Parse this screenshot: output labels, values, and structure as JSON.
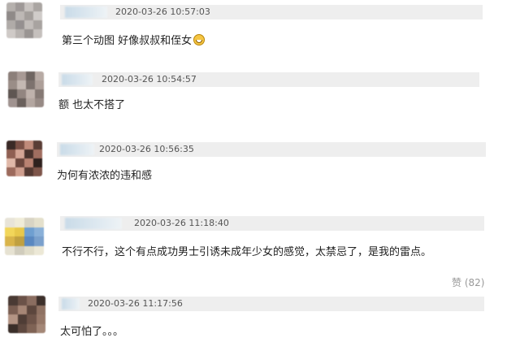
{
  "comments": [
    {
      "timestamp": "2020-03-26 10:57:03",
      "text": "第三个动图 好像叔叔和侄女",
      "emoji": "grinning-face-emoji",
      "avatar_colors": [
        "#b5b0ad",
        "#9e9897",
        "#c8c3c0",
        "#aaa5a2",
        "#8f8a88",
        "#bdb8b5",
        "#a39e9b",
        "#d0ccc9",
        "#b0aba8",
        "#959090",
        "#c2bdba",
        "#a8a3a0",
        "#cfcac7",
        "#b8b3b0",
        "#9a9593",
        "#c5c0bd"
      ]
    },
    {
      "timestamp": "2020-03-26 10:54:57",
      "text": "额 也太不搭了",
      "avatar_colors": [
        "#8c7f7a",
        "#a89a95",
        "#6f6561",
        "#b7aaa4",
        "#9a8d87",
        "#c4b8b2",
        "#7d726e",
        "#ad9f99",
        "#5f5652",
        "#928580",
        "#bfb2ac",
        "#857974",
        "#a09390",
        "#6a605c",
        "#b3a6a0",
        "#978a85"
      ]
    },
    {
      "timestamp": "2020-03-26 10:56:35",
      "text": "为何有浓浓的违和感",
      "avatar_colors": [
        "#3a2a26",
        "#7a4f45",
        "#c08a7a",
        "#5a3d36",
        "#8f5f52",
        "#d4a595",
        "#4a332d",
        "#a06e60",
        "#e0b8a8",
        "#6b463d",
        "#b98272",
        "#2e211e",
        "#9c6a5c",
        "#cf9e8e",
        "#553a33",
        "#7e554a"
      ]
    },
    {
      "timestamp": "2020-03-26 11:18:40",
      "text": "不行不行，这个有点成功男士引诱未成年少女的感觉，太禁忌了，是我的雷点。",
      "like_label": "赞",
      "like_count": "(82)",
      "avatar_colors": [
        "#e8e4d8",
        "#f0ecd8",
        "#d8d4c4",
        "#e4e0cc",
        "#f2d65a",
        "#e8c84a",
        "#6f9fd0",
        "#8ab0d8",
        "#d9b44a",
        "#c0a040",
        "#5a88c0",
        "#7aa0cc",
        "#e6e2d2",
        "#d0ccbc",
        "#e0dcc8",
        "#ecE8d6"
      ]
    },
    {
      "timestamp": "2020-03-26 11:17:56",
      "text": "太可怕了。。。",
      "avatar_colors": [
        "#4a3a34",
        "#6b5248",
        "#8a6d60",
        "#3d302b",
        "#7a5e52",
        "#a68676",
        "#5c463d",
        "#8f7263",
        "#b39484",
        "#4f3d36",
        "#6e5449",
        "#967868",
        "#3a2e29",
        "#5e483f",
        "#7f6355",
        "#a48777"
      ]
    }
  ]
}
